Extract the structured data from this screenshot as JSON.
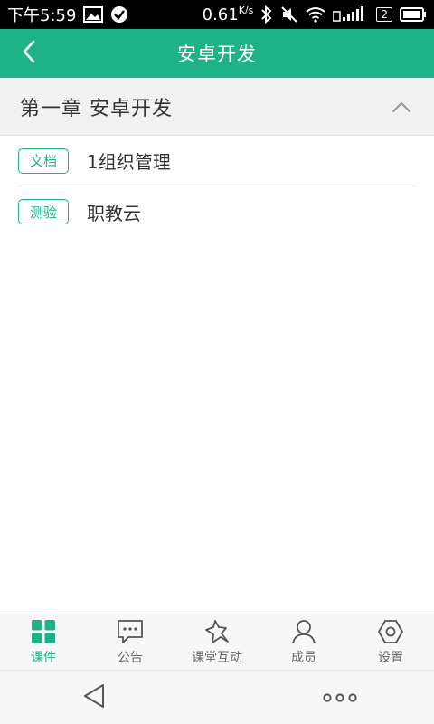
{
  "status_bar": {
    "time": "下午5:59",
    "speed_value": "0.61",
    "speed_unit": "K/s",
    "sim_badge": "2"
  },
  "header": {
    "title": "安卓开发",
    "back_icon": "chevron-left-icon"
  },
  "chapter": {
    "title": "第一章 安卓开发",
    "toggle_icon": "chevron-up-icon"
  },
  "items": [
    {
      "tag": "文档",
      "text": "1组织管理"
    },
    {
      "tag": "测验",
      "text": "职教云"
    }
  ],
  "tabs": [
    {
      "label": "课件",
      "icon": "grid-icon",
      "active": true
    },
    {
      "label": "公告",
      "icon": "message-icon",
      "active": false
    },
    {
      "label": "课堂互动",
      "icon": "star-icon",
      "active": false
    },
    {
      "label": "成员",
      "icon": "user-icon",
      "active": false
    },
    {
      "label": "设置",
      "icon": "settings-icon",
      "active": false
    }
  ],
  "colors": {
    "brand": "#1db386",
    "tab_inactive": "#666666"
  }
}
